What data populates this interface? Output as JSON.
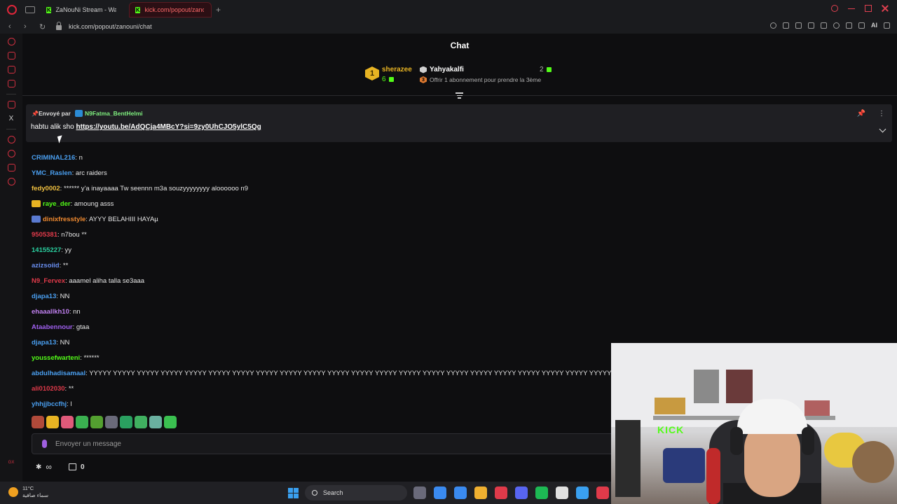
{
  "browser": {
    "tabs": [
      {
        "label": "ZaNouNi Stream - Watch l",
        "active": false
      },
      {
        "label": "kick.com/popout/zanouni/",
        "active": true
      }
    ],
    "url": "kick.com/popout/zanouni/chat",
    "ai_label": "AI"
  },
  "chat": {
    "title": "Chat",
    "leaderboard": {
      "first": {
        "rank": "1",
        "name": "sherazee",
        "count": "6"
      },
      "second": {
        "name": "Yahyakalfi",
        "count": "2",
        "offer_badge": "3",
        "offer": "Offrir 1 abonnement pour prendre la 3ème"
      }
    },
    "pinned": {
      "sent_by_label": "Envoyé par",
      "user": "N9Fatma_BentHelmi",
      "text": "habtu alik sho ",
      "link": "https://youtu.be/AdQCja4MBcY?si=9zy0UhCJO5ylC5Qg"
    },
    "messages": [
      {
        "user": "CRIMINAL216",
        "text": ": n",
        "color": "#4a9ff0",
        "badge": ""
      },
      {
        "user": "YMC_Raslen",
        "text": ": arc raiders",
        "color": "#4a9ff0",
        "badge": ""
      },
      {
        "user": "fedy0002",
        "text": ": ****** y'a inayaaaa Tw seennn m3a souzyyyyyyyy aloooooo n9",
        "color": "#f0c040",
        "badge": ""
      },
      {
        "user": "raye_der",
        "text": ": amoung asss",
        "color": "#53fc18",
        "badge": "#e8b423"
      },
      {
        "user": "dinixfresstyle",
        "text": ": AYYY BELAHIII HAYAµ",
        "color": "#f08a30",
        "badge": "#5a7ad0"
      },
      {
        "user": "9505381",
        "text": ": n7bou **",
        "color": "#e03a4a",
        "badge": ""
      },
      {
        "user": "14155227",
        "text": ": yy",
        "color": "#2ad0a0",
        "badge": ""
      },
      {
        "user": "azizsoiid",
        "text": ": **",
        "color": "#6a8ff0",
        "badge": ""
      },
      {
        "user": "N9_Fervex",
        "text": ": aaamel aliha talla se3aaa",
        "color": "#e03a4a",
        "badge": ""
      },
      {
        "user": "djapa13",
        "text": ": NN",
        "color": "#4a9ff0",
        "badge": ""
      },
      {
        "user": "ehaaallkh10",
        "text": ": nn",
        "color": "#c080f0",
        "badge": ""
      },
      {
        "user": "Ataabennour",
        "text": ": gtaa",
        "color": "#a060f0",
        "badge": ""
      },
      {
        "user": "djapa13",
        "text": ": NN",
        "color": "#4a9ff0",
        "badge": ""
      },
      {
        "user": "youssefwarteni",
        "text": ": ******",
        "color": "#53fc18",
        "badge": ""
      },
      {
        "user": "abdulhadisamaal",
        "text": ": YYYYY YYYYY YYYYY YYYYY YYYYY YYYYY YYYYY YYYYY YYYYY YYYYY YYYYY YYYYY YYYYY YYYYY YYYYY YYYYY YYYYY YYYYY YYYYY YYYYY YYYYY YYYYY",
        "color": "#4a9ff0",
        "badge": ""
      },
      {
        "user": "ali0102030",
        "text": ": **",
        "color": "#e03a4a",
        "badge": ""
      },
      {
        "user": "yhhjjbccfhj",
        "text": ": l",
        "color": "#4a9ff0",
        "badge": ""
      }
    ],
    "emotes": [
      "#b04a3a",
      "#e8b423",
      "#e05a7a",
      "#3ab050",
      "#53a030",
      "#6a6a7a",
      "#2aa060",
      "#40b060",
      "#6ab0a0",
      "#3ac050"
    ],
    "input_placeholder": "Envoyer un message",
    "points": "0"
  },
  "taskbar": {
    "temperature": "11°C",
    "weather": "سماء صافية",
    "search_label": "Search",
    "apps": [
      "#6a6a7a",
      "#3a8af0",
      "#3a8af0",
      "#f0b030",
      "#e03a4a",
      "#5865f2",
      "#1db954",
      "#e0e0e0",
      "#3aa0f0",
      "#e03a4a"
    ]
  }
}
